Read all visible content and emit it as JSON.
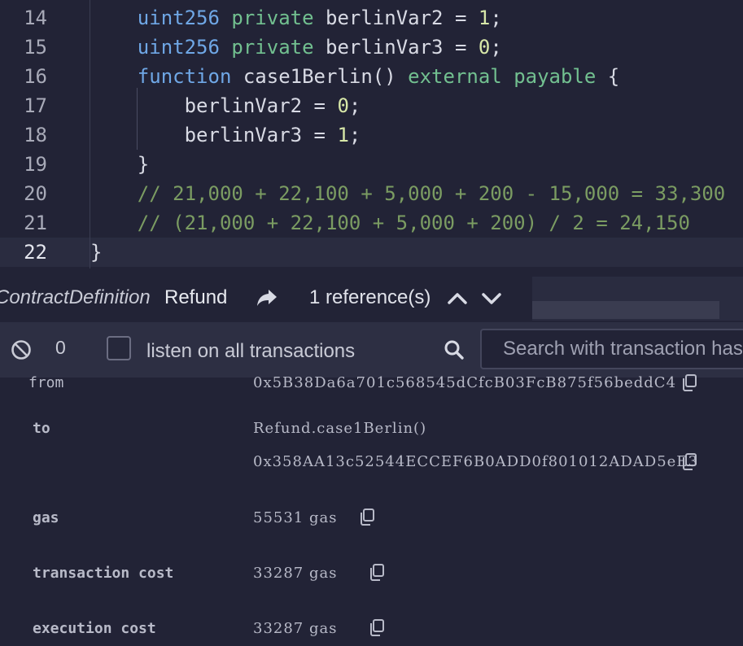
{
  "editor": {
    "lines": [
      {
        "num": "14",
        "indent": "    ",
        "parts": [
          [
            "kw",
            "uint256"
          ],
          [
            "t",
            " "
          ],
          [
            "mod",
            "private"
          ],
          [
            "t",
            " berlinVar2 = "
          ],
          [
            "num",
            "1"
          ],
          [
            "t",
            ";"
          ]
        ]
      },
      {
        "num": "15",
        "indent": "    ",
        "parts": [
          [
            "kw",
            "uint256"
          ],
          [
            "t",
            " "
          ],
          [
            "mod",
            "private"
          ],
          [
            "t",
            " berlinVar3 = "
          ],
          [
            "num",
            "0"
          ],
          [
            "t",
            ";"
          ]
        ]
      },
      {
        "num": "16",
        "indent": "    ",
        "parts": [
          [
            "kw",
            "function"
          ],
          [
            "t",
            " case1Berlin() "
          ],
          [
            "mod",
            "external"
          ],
          [
            "t",
            " "
          ],
          [
            "mod",
            "payable"
          ],
          [
            "t",
            " {"
          ]
        ]
      },
      {
        "num": "17",
        "indent": "        ",
        "parts": [
          [
            "t",
            "berlinVar2 = "
          ],
          [
            "num",
            "0"
          ],
          [
            "t",
            ";"
          ]
        ]
      },
      {
        "num": "18",
        "indent": "        ",
        "parts": [
          [
            "t",
            "berlinVar3 = "
          ],
          [
            "num",
            "1"
          ],
          [
            "t",
            ";"
          ]
        ]
      },
      {
        "num": "19",
        "indent": "    ",
        "parts": [
          [
            "t",
            "}"
          ]
        ]
      },
      {
        "num": "20",
        "indent": "    ",
        "parts": [
          [
            "cmt",
            "// 21,000 + 22,100 + 5,000 + 200 - 15,000 = 33,300"
          ]
        ]
      },
      {
        "num": "21",
        "indent": "    ",
        "parts": [
          [
            "cmt",
            "// (21,000 + 22,100 + 5,000 + 200) / 2 = 24,150"
          ]
        ]
      },
      {
        "num": "22",
        "indent": "",
        "parts": [
          [
            "t",
            "}"
          ]
        ]
      }
    ],
    "active_line": "22"
  },
  "reference_bar": {
    "context": "ContractDefinition",
    "name": "Refund",
    "references": "1 reference(s)"
  },
  "terminal_bar": {
    "count": "0",
    "listen_label": "listen on all transactions",
    "search_placeholder": "Search with transaction hash or address"
  },
  "details": {
    "from_label": "from",
    "from_value": "0x5B38Da6a701c568545dCfcB03FcB875f56beddC4",
    "to_label": "to",
    "to_value": "Refund.case1Berlin()",
    "to_address": "0x358AA13c52544ECCEF6B0ADD0f801012ADAD5eE3",
    "gas_label": "gas",
    "gas_value": "55531 gas",
    "tx_cost_label": "transaction cost",
    "tx_cost_value": "33287 gas",
    "exec_cost_label": "execution cost",
    "exec_cost_value": "33287 gas"
  },
  "icons": {
    "forward": "share-arrow-icon",
    "up": "chevron-up-icon",
    "down": "chevron-down-icon",
    "clear": "no-entry-icon",
    "search": "search-icon",
    "copy": "copy-icon"
  },
  "colors": {
    "keyword": "#6fa7e6",
    "modifier": "#72c090",
    "number": "#d7e7a8",
    "comment": "#7b9c62",
    "background": "#222336"
  }
}
